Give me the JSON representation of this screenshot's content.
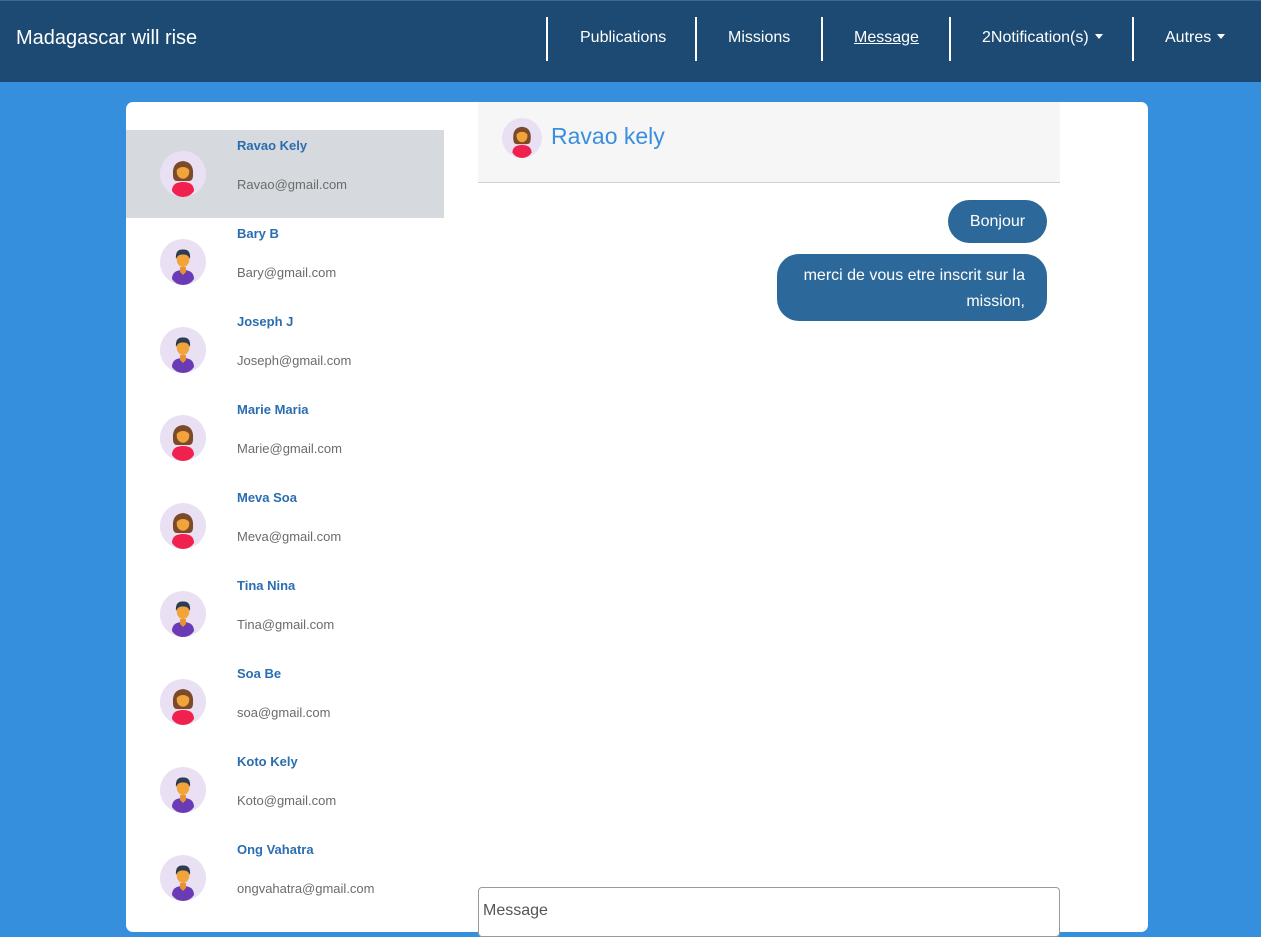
{
  "app": {
    "title": "Madagascar will rise"
  },
  "nav": {
    "publications": "Publications",
    "missions": "Missions",
    "message": "Message",
    "notifications": "2Notification(s)",
    "autres": "Autres"
  },
  "contacts": [
    {
      "name": "Ravao Kely",
      "email": "Ravao@gmail.com",
      "avatar": "female-avatar-icon",
      "selected": true
    },
    {
      "name": "Bary B",
      "email": "Bary@gmail.com",
      "avatar": "male-avatar-icon"
    },
    {
      "name": "Joseph J",
      "email": "Joseph@gmail.com",
      "avatar": "male-avatar-icon"
    },
    {
      "name": "Marie Maria",
      "email": "Marie@gmail.com",
      "avatar": "female-avatar-icon"
    },
    {
      "name": "Meva Soa",
      "email": "Meva@gmail.com",
      "avatar": "female-avatar-icon"
    },
    {
      "name": "Tina Nina",
      "email": "Tina@gmail.com",
      "avatar": "male-avatar-icon"
    },
    {
      "name": "Soa Be",
      "email": "soa@gmail.com",
      "avatar": "female-avatar-icon"
    },
    {
      "name": "Koto Kely",
      "email": "Koto@gmail.com",
      "avatar": "male-avatar-icon"
    },
    {
      "name": "Ong Vahatra",
      "email": "ongvahatra@gmail.com",
      "avatar": "male-avatar-icon"
    }
  ],
  "chat": {
    "recipient": "Ravao kely",
    "messages": [
      {
        "text": "Bonjour"
      },
      {
        "text": "merci de vous etre inscrit sur la mission,"
      }
    ],
    "input_placeholder": "Message"
  },
  "colors": {
    "navbar": "#1c4a73",
    "background": "#358fdd",
    "bubble": "#2c6899",
    "contact_name": "#2a6db0",
    "selected_row": "#d6d9dd"
  }
}
